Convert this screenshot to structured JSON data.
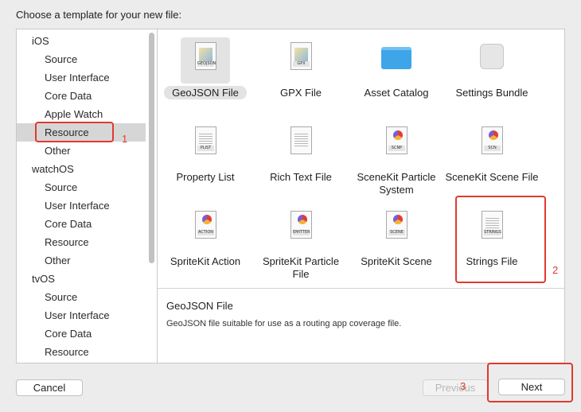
{
  "header": {
    "title": "Choose a template for your new file:"
  },
  "sidebar": {
    "rows": [
      {
        "label": "iOS",
        "kind": "group"
      },
      {
        "label": "Source",
        "kind": "item"
      },
      {
        "label": "User Interface",
        "kind": "item"
      },
      {
        "label": "Core Data",
        "kind": "item"
      },
      {
        "label": "Apple Watch",
        "kind": "item"
      },
      {
        "label": "Resource",
        "kind": "item",
        "selected": true
      },
      {
        "label": "Other",
        "kind": "item"
      },
      {
        "label": "watchOS",
        "kind": "group"
      },
      {
        "label": "Source",
        "kind": "item"
      },
      {
        "label": "User Interface",
        "kind": "item"
      },
      {
        "label": "Core Data",
        "kind": "item"
      },
      {
        "label": "Resource",
        "kind": "item"
      },
      {
        "label": "Other",
        "kind": "item"
      },
      {
        "label": "tvOS",
        "kind": "group"
      },
      {
        "label": "Source",
        "kind": "item"
      },
      {
        "label": "User Interface",
        "kind": "item"
      },
      {
        "label": "Core Data",
        "kind": "item"
      },
      {
        "label": "Resource",
        "kind": "item"
      }
    ]
  },
  "templates": [
    {
      "label": "GeoJSON File",
      "icon": "geojson-doc-icon",
      "tag": "GEOJSON",
      "selected": true
    },
    {
      "label": "GPX File",
      "icon": "gpx-doc-icon",
      "tag": "GPX"
    },
    {
      "label": "Asset Catalog",
      "icon": "folder-icon"
    },
    {
      "label": "Settings Bundle",
      "icon": "settings-bundle-icon"
    },
    {
      "label": "Property List",
      "icon": "plist-doc-icon",
      "tag": "PLIST"
    },
    {
      "label": "Rich Text File",
      "icon": "rich-text-doc-icon"
    },
    {
      "label": "SceneKit Particle System",
      "icon": "scnp-doc-icon",
      "tag": "SCNP"
    },
    {
      "label": "SceneKit Scene File",
      "icon": "scn-doc-icon",
      "tag": "SCN"
    },
    {
      "label": "SpriteKit Action",
      "icon": "action-doc-icon",
      "tag": "ACTION"
    },
    {
      "label": "SpriteKit Particle File",
      "icon": "emitter-doc-icon",
      "tag": "EMITTER"
    },
    {
      "label": "SpriteKit Scene",
      "icon": "scene-doc-icon",
      "tag": "SCENE"
    },
    {
      "label": "Strings File",
      "icon": "strings-doc-icon",
      "tag": "STRINGS"
    }
  ],
  "description": {
    "title": "GeoJSON File",
    "text": "GeoJSON file suitable for use as a routing app coverage file."
  },
  "buttons": {
    "cancel": "Cancel",
    "previous": "Previous",
    "next": "Next"
  },
  "annotations": {
    "one": "1",
    "two": "2",
    "three": "3"
  },
  "colors": {
    "annotation": "#e03a2f",
    "selection": "#d6d6d6"
  }
}
